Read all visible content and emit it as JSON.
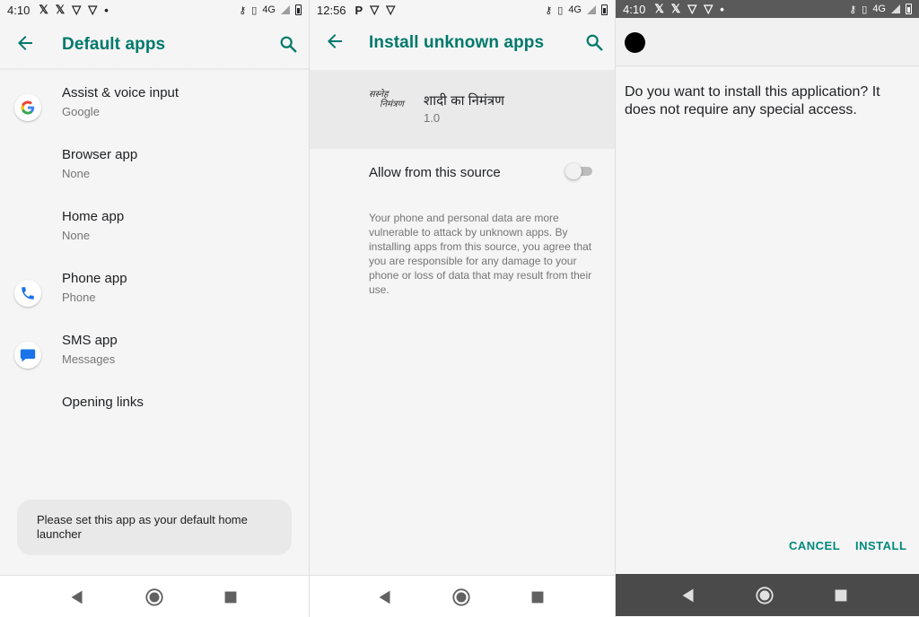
{
  "panel1": {
    "status": {
      "time": "4:10",
      "network": "4G"
    },
    "title": "Default apps",
    "items": [
      {
        "label": "Assist & voice input",
        "sub": "Google",
        "icon": "google-icon"
      },
      {
        "label": "Browser app",
        "sub": "None",
        "icon": ""
      },
      {
        "label": "Home app",
        "sub": "None",
        "icon": ""
      },
      {
        "label": "Phone app",
        "sub": "Phone",
        "icon": "phone-icon"
      },
      {
        "label": "SMS app",
        "sub": "Messages",
        "icon": "messages-icon"
      },
      {
        "label": "Opening links",
        "sub": "",
        "icon": ""
      }
    ],
    "toast": "Please set this app as your default home launcher"
  },
  "panel2": {
    "status": {
      "time": "12:56",
      "network": "4G"
    },
    "title": "Install unknown apps",
    "app_name": "शादी का निमंत्रण",
    "app_version": "1.0",
    "logo_text": [
      "सस्नेह",
      "निमंत्रण"
    ],
    "allow_label": "Allow from this source",
    "allow_enabled": false,
    "warning": "Your phone and personal data are more vulnerable to attack by unknown apps. By installing apps from this source, you agree that you are responsible for any damage to your phone or loss of data that may result from their use."
  },
  "panel3": {
    "status": {
      "time": "4:10",
      "network": "4G"
    },
    "question": "Do you want to install this application? It does not require any special access.",
    "cancel_label": "CANCEL",
    "install_label": "INSTALL"
  },
  "colors": {
    "accent": "#00796b",
    "button": "#00897b",
    "background": "#f5f5f5"
  }
}
